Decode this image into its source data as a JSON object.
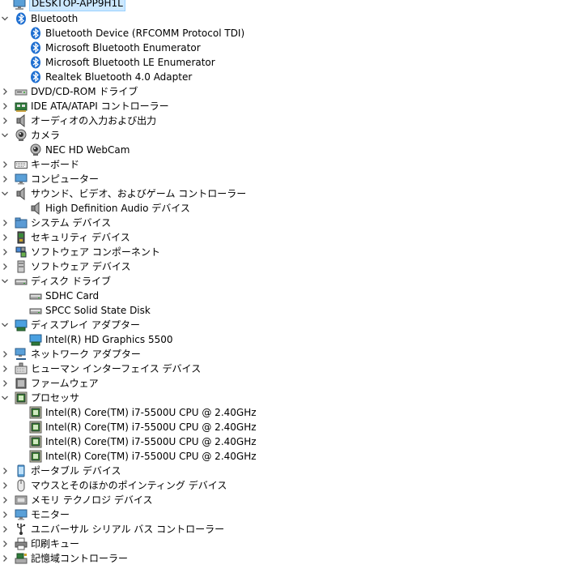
{
  "window": {
    "root_label": "DESKTOP-APP9H1L",
    "root_icon": "computer-icon"
  },
  "colors": {
    "bluetooth": "#1f6fd1",
    "selection": "#cce8ff",
    "chevron": "#555555",
    "chip": "#3a7a2a"
  },
  "nodes": [
    {
      "label": "Bluetooth",
      "icon": "bluetooth-icon",
      "expanded": true,
      "children": [
        {
          "label": "Bluetooth Device (RFCOMM Protocol TDI)",
          "icon": "bluetooth-icon"
        },
        {
          "label": "Microsoft Bluetooth Enumerator",
          "icon": "bluetooth-icon"
        },
        {
          "label": "Microsoft Bluetooth LE Enumerator",
          "icon": "bluetooth-icon"
        },
        {
          "label": "Realtek Bluetooth 4.0 Adapter",
          "icon": "bluetooth-icon"
        }
      ]
    },
    {
      "label": "DVD/CD-ROM ドライブ",
      "icon": "dvd-drive-icon",
      "expanded": false
    },
    {
      "label": "IDE ATA/ATAPI コントローラー",
      "icon": "ide-controller-icon",
      "expanded": false
    },
    {
      "label": "オーディオの入力および出力",
      "icon": "speaker-icon",
      "expanded": false
    },
    {
      "label": "カメラ",
      "icon": "camera-icon",
      "expanded": true,
      "children": [
        {
          "label": "NEC HD WebCam",
          "icon": "camera-icon"
        }
      ]
    },
    {
      "label": "キーボード",
      "icon": "keyboard-icon",
      "expanded": false
    },
    {
      "label": "コンピューター",
      "icon": "monitor-icon",
      "expanded": false
    },
    {
      "label": "サウンド、ビデオ、およびゲーム コントローラー",
      "icon": "speaker-icon",
      "expanded": true,
      "children": [
        {
          "label": "High Definition Audio デバイス",
          "icon": "speaker-icon"
        }
      ]
    },
    {
      "label": "システム デバイス",
      "icon": "folder-device-icon",
      "expanded": false
    },
    {
      "label": "セキュリティ デバイス",
      "icon": "security-device-icon",
      "expanded": false
    },
    {
      "label": "ソフトウェア コンポーネント",
      "icon": "software-component-icon",
      "expanded": false
    },
    {
      "label": "ソフトウェア デバイス",
      "icon": "software-device-icon",
      "expanded": false
    },
    {
      "label": "ディスク ドライブ",
      "icon": "disk-drive-icon",
      "expanded": true,
      "children": [
        {
          "label": "SDHC Card",
          "icon": "disk-drive-icon"
        },
        {
          "label": "SPCC Solid State Disk",
          "icon": "disk-drive-icon"
        }
      ]
    },
    {
      "label": "ディスプレイ アダプター",
      "icon": "display-adapter-icon",
      "expanded": true,
      "children": [
        {
          "label": "Intel(R) HD Graphics 5500",
          "icon": "display-adapter-icon"
        }
      ]
    },
    {
      "label": "ネットワーク アダプター",
      "icon": "network-adapter-icon",
      "expanded": false
    },
    {
      "label": "ヒューマン インターフェイス デバイス",
      "icon": "hid-icon",
      "expanded": false
    },
    {
      "label": "ファームウェア",
      "icon": "firmware-icon",
      "expanded": false
    },
    {
      "label": "プロセッサ",
      "icon": "processor-icon",
      "expanded": true,
      "children": [
        {
          "label": "Intel(R) Core(TM) i7-5500U CPU @ 2.40GHz",
          "icon": "processor-icon"
        },
        {
          "label": "Intel(R) Core(TM) i7-5500U CPU @ 2.40GHz",
          "icon": "processor-icon"
        },
        {
          "label": "Intel(R) Core(TM) i7-5500U CPU @ 2.40GHz",
          "icon": "processor-icon"
        },
        {
          "label": "Intel(R) Core(TM) i7-5500U CPU @ 2.40GHz",
          "icon": "processor-icon"
        }
      ]
    },
    {
      "label": "ポータブル デバイス",
      "icon": "portable-device-icon",
      "expanded": false
    },
    {
      "label": "マウスとそのほかのポインティング デバイス",
      "icon": "mouse-icon",
      "expanded": false
    },
    {
      "label": "メモリ テクノロジ デバイス",
      "icon": "memory-device-icon",
      "expanded": false
    },
    {
      "label": "モニター",
      "icon": "monitor-icon",
      "expanded": false
    },
    {
      "label": "ユニバーサル シリアル バス コントローラー",
      "icon": "usb-controller-icon",
      "expanded": false
    },
    {
      "label": "印刷キュー",
      "icon": "printer-icon",
      "expanded": false
    },
    {
      "label": "記憶域コントローラー",
      "icon": "storage-controller-icon",
      "expanded": false
    }
  ]
}
